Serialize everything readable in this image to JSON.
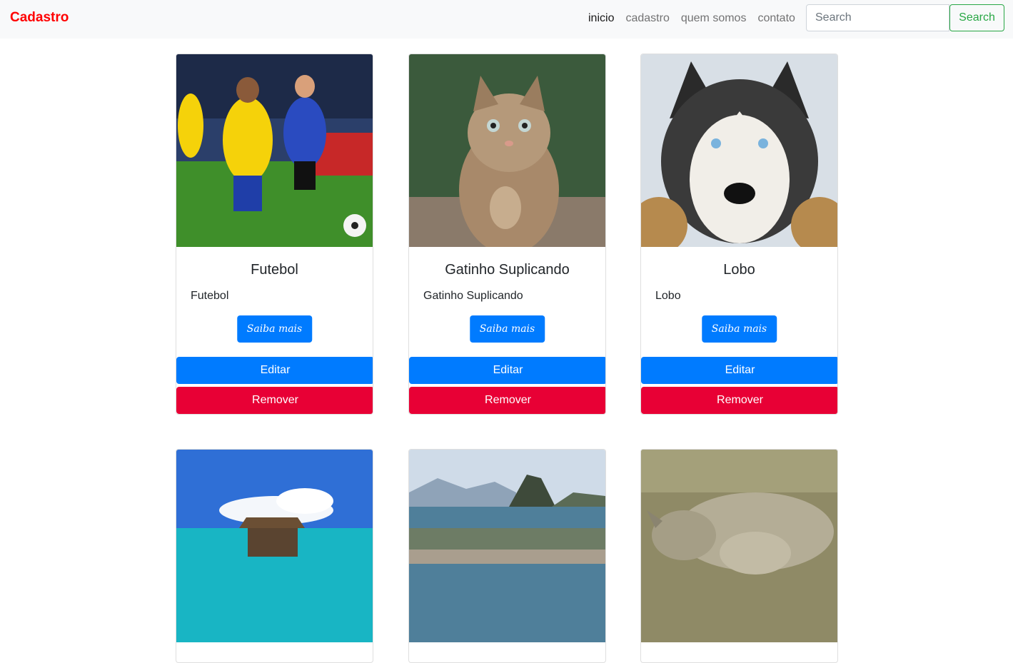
{
  "navbar": {
    "brand": "Cadastro",
    "links": [
      "inicio",
      "cadastro",
      "quem somos",
      "contato"
    ],
    "search_placeholder": "Search",
    "search_button": "Search"
  },
  "cards": [
    {
      "title": "Futebol",
      "text": "Futebol",
      "more": "Saiba mais",
      "edit": "Editar",
      "remove": "Remover",
      "image": "soccer-players-photo"
    },
    {
      "title": "Gatinho Suplicando",
      "text": "Gatinho Suplicando",
      "more": "Saiba mais",
      "edit": "Editar",
      "remove": "Remover",
      "image": "kitten-begging-photo"
    },
    {
      "title": "Lobo",
      "text": "Lobo",
      "more": "Saiba mais",
      "edit": "Editar",
      "remove": "Remover",
      "image": "husky-wolf-photo"
    },
    {
      "image": "tropical-beach-pier-photo"
    },
    {
      "image": "rio-sugarloaf-mountain-photo"
    },
    {
      "image": "rhinoceros-savanna-photo"
    }
  ],
  "colors": {
    "brand": "#ff0000",
    "primary": "#007bff",
    "danger": "#e80035",
    "success": "#28a745"
  }
}
